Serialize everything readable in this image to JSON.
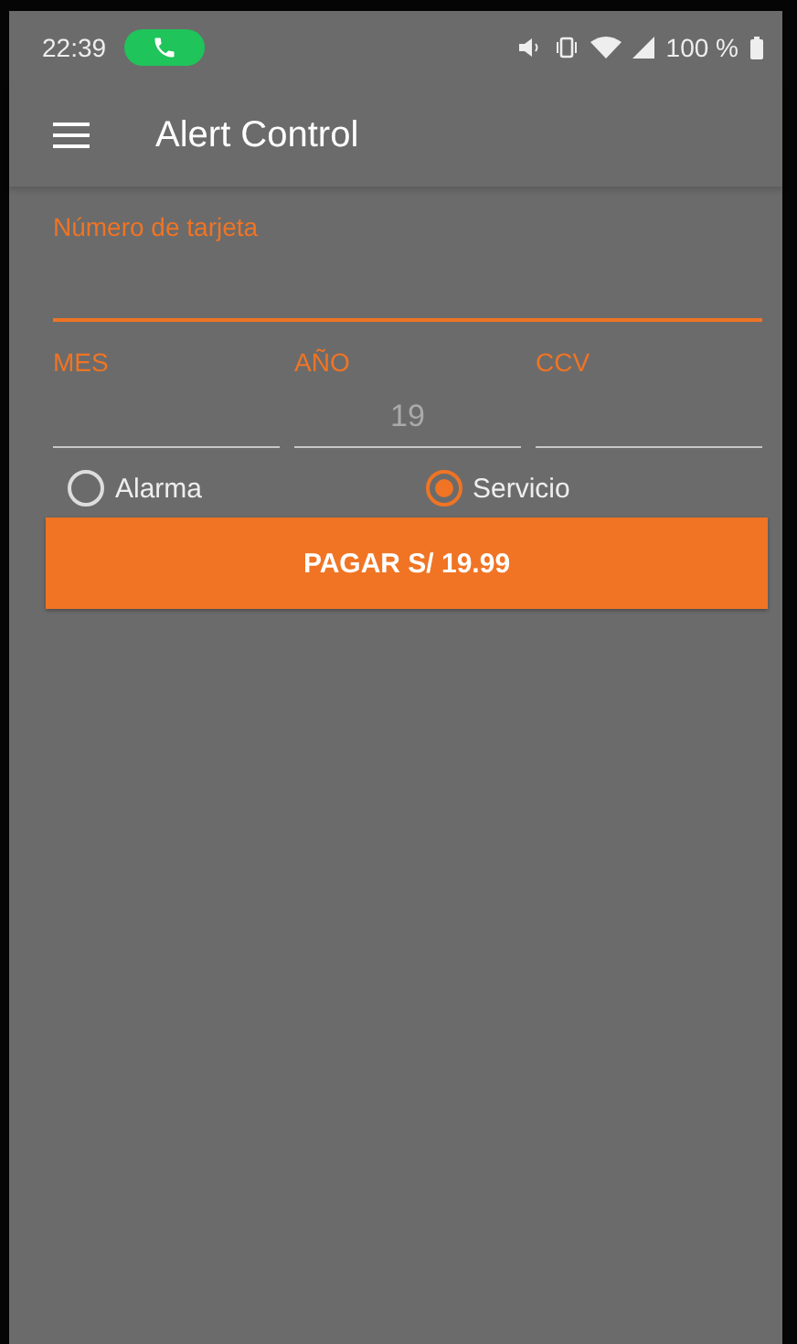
{
  "status_bar": {
    "time": "22:39",
    "call_active": true,
    "battery": "100 %"
  },
  "toolbar": {
    "title": "Alert Control"
  },
  "card_field": {
    "label": "Número de tarjeta",
    "focused": true
  },
  "fields": [
    {
      "label": "MES"
    },
    {
      "label": "AÑO",
      "value": "19"
    },
    {
      "label": "CCV"
    }
  ],
  "radios": [
    {
      "label": "Alarma",
      "selected": false
    },
    {
      "label": "Servicio",
      "selected": true
    }
  ],
  "pay_button": {
    "label": "PAGAR S/ 19.99"
  }
}
